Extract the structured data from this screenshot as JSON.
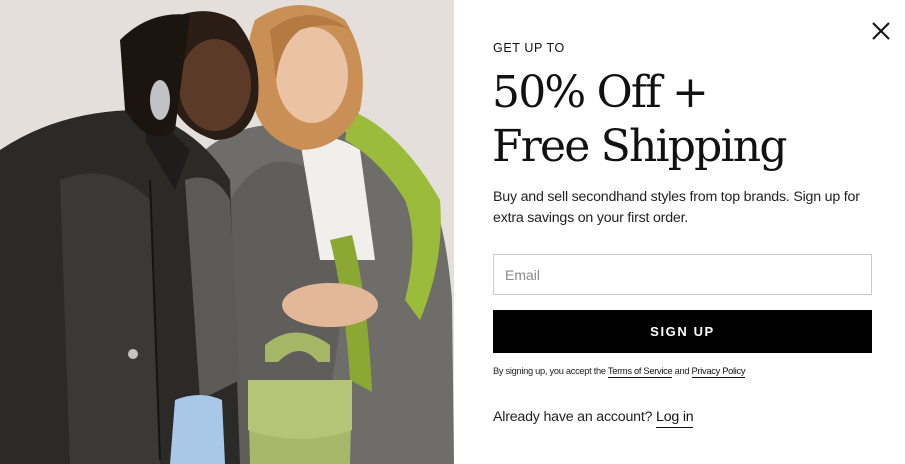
{
  "modal": {
    "close_icon": "close-icon",
    "eyebrow": "GET UP TO",
    "headline_line1": "50% Off +",
    "headline_line2": "Free Shipping",
    "subtext": "Buy and sell secondhand styles from top brands. Sign up for extra savings on your first order.",
    "email_placeholder": "Email",
    "email_value": "",
    "signup_label": "SIGN UP",
    "legal_prefix": "By signing up, you accept the",
    "terms_label": "Terms of Service",
    "legal_and": "and",
    "privacy_label": "Privacy Policy",
    "login_prompt": "Already have an account?",
    "login_label": "Log in"
  },
  "colors": {
    "button_bg": "#000000",
    "button_text": "#ffffff",
    "photo_bg": "#e2ddd8",
    "jacket_leather": "#2b2a27",
    "coat_grey": "#6d6c68",
    "scarf_green": "#9bbb3a",
    "bag_green": "#a8b86a"
  }
}
